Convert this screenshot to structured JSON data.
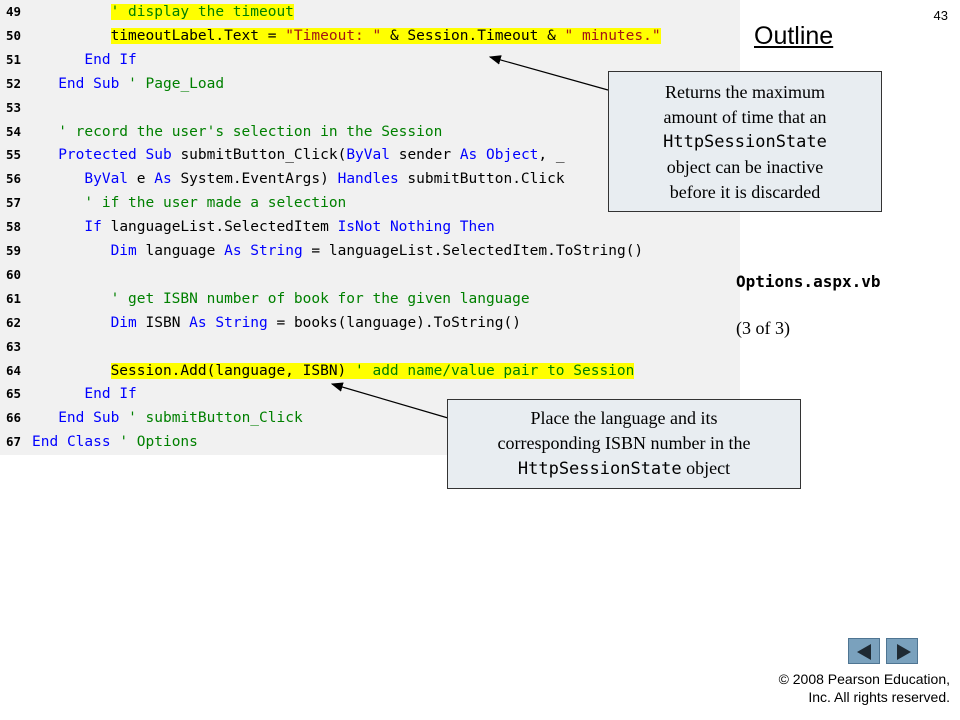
{
  "slide": {
    "number": "43",
    "outline_title": "Outline",
    "file_name": "Options.aspx.vb",
    "part": "(3 of 3)"
  },
  "code_lines": [
    {
      "num": "49",
      "text": "         ' display the timeout"
    },
    {
      "num": "50",
      "text": "         timeoutLabel.Text = \"Timeout: \" & Session.Timeout & \" minutes.\""
    },
    {
      "num": "51",
      "text": "      End If"
    },
    {
      "num": "52",
      "text": "   End Sub ' Page_Load"
    },
    {
      "num": "53",
      "text": ""
    },
    {
      "num": "54",
      "text": "   ' record the user's selection in the Session"
    },
    {
      "num": "55",
      "text": "   Protected Sub submitButton_Click(ByVal sender As Object, _"
    },
    {
      "num": "56",
      "text": "      ByVal e As System.EventArgs) Handles submitButton.Click"
    },
    {
      "num": "57",
      "text": "      ' if the user made a selection"
    },
    {
      "num": "58",
      "text": "      If languageList.SelectedItem IsNot Nothing Then"
    },
    {
      "num": "59",
      "text": "         Dim language As String = languageList.SelectedItem.ToString()"
    },
    {
      "num": "60",
      "text": ""
    },
    {
      "num": "61",
      "text": "         ' get ISBN number of book for the given language"
    },
    {
      "num": "62",
      "text": "         Dim ISBN As String = books(language).ToString()"
    },
    {
      "num": "63",
      "text": ""
    },
    {
      "num": "64",
      "text": "         Session.Add(language, ISBN) ' add name/value pair to Session"
    },
    {
      "num": "65",
      "text": "      End If"
    },
    {
      "num": "66",
      "text": "   End Sub ' submitButton_Click"
    },
    {
      "num": "67",
      "text": "End Class ' Options"
    }
  ],
  "highlighted_lines": [
    "49",
    "50",
    "64"
  ],
  "callouts": {
    "timeout": {
      "line1": "Returns the maximum",
      "line2": "amount of time that an",
      "mono": "HttpSessionState",
      "line3": "object can be inactive",
      "line4": "before it is discarded"
    },
    "session_add": {
      "line1": "Place the language and its",
      "line2": "corresponding ISBN number in the",
      "mono": "HttpSessionState",
      "line3": "object"
    }
  },
  "footer": {
    "copyright_line1": "© 2008 Pearson Education,",
    "copyright_line2": "Inc.  All rights reserved."
  },
  "colors": {
    "highlight": "#ffff00",
    "keyword": "#0000ff",
    "comment": "#008000",
    "string": "#a31515",
    "code_background": "#f1f1f1",
    "callout_background": "#e8edf1",
    "nav_button": "#7aa1bd"
  },
  "icons": {
    "prev": "triangle-left-icon",
    "next": "triangle-right-icon"
  }
}
